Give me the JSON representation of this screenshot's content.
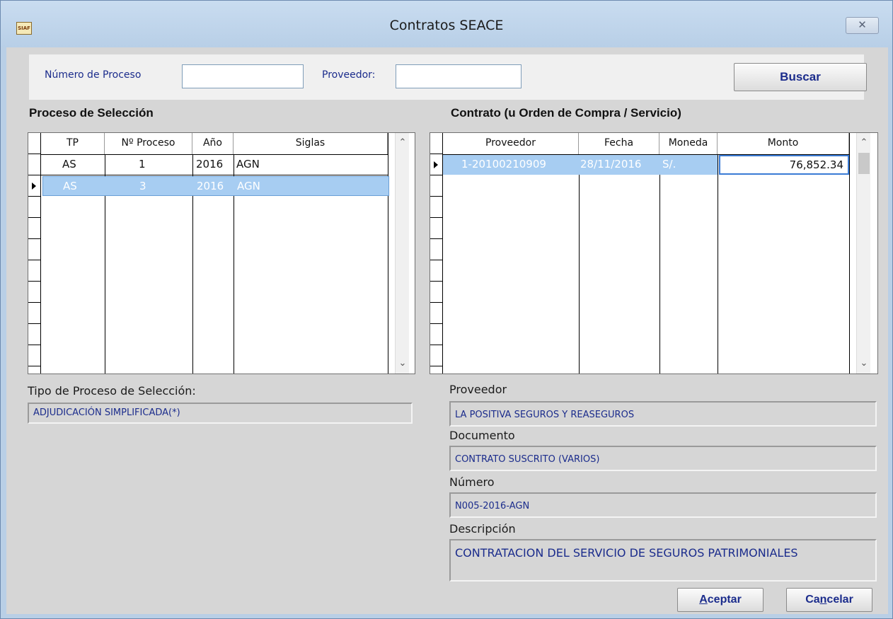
{
  "window": {
    "title": "Contratos SEACE",
    "app_icon_text": "SIAF",
    "close_glyph": "✕"
  },
  "search": {
    "numero_label": "Número de Proceso",
    "numero_value": "",
    "proveedor_label": "Proveedor:",
    "proveedor_value": "",
    "buscar_label": "Buscar"
  },
  "proceso": {
    "title": "Proceso de Selección",
    "columns": [
      "TP",
      "Nº Proceso",
      "Año",
      "Siglas"
    ],
    "rows": [
      {
        "tp": "AS",
        "num": "1",
        "anio": "2016",
        "siglas": "AGN"
      },
      {
        "tp": "AS",
        "num": "3",
        "anio": "2016",
        "siglas": "AGN"
      }
    ],
    "selected_index": 1,
    "tipo_label": "Tipo de Proceso de Selección:",
    "tipo_value": "ADJUDICACIÓN SIMPLIFICADA(*)"
  },
  "contrato": {
    "title": "Contrato (u Orden de Compra / Servicio)",
    "columns": [
      "Proveedor",
      "Fecha",
      "Moneda",
      "Monto"
    ],
    "rows": [
      {
        "proveedor": "1-20100210909",
        "fecha": "28/11/2016",
        "moneda": "S/.",
        "monto": "76,852.34"
      }
    ],
    "selected_index": 0
  },
  "details": {
    "proveedor_label": "Proveedor",
    "proveedor_value": "LA POSITIVA SEGUROS Y REASEGUROS",
    "documento_label": "Documento",
    "documento_value": "CONTRATO SUSCRITO (VARIOS)",
    "numero_label": "Número",
    "numero_value": "N005-2016-AGN",
    "descripcion_label": "Descripción",
    "descripcion_value": "CONTRATACION DEL SERVICIO DE SEGUROS PATRIMONIALES"
  },
  "buttons": {
    "aceptar_key": "A",
    "aceptar_rest": "ceptar",
    "cancelar_pre": "Ca",
    "cancelar_key": "n",
    "cancelar_rest": "celar"
  },
  "icons": {
    "scroll_up": "⌃",
    "scroll_down": "⌄"
  },
  "colors": {
    "selection": "#a7cdf2",
    "label_blue": "#1b2c8c",
    "title_bar": "#b9cfe6"
  }
}
